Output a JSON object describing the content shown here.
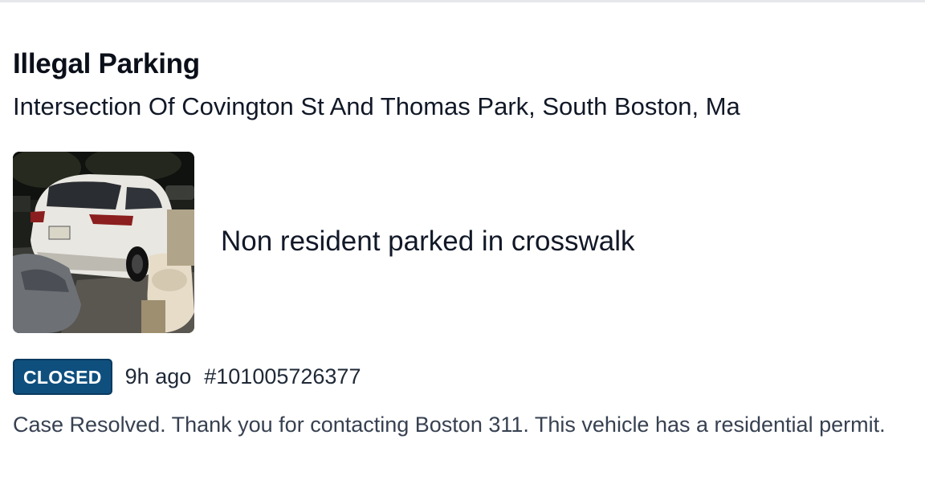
{
  "case": {
    "title": "Illegal Parking",
    "address": "Intersection Of Covington St And Thomas Park, South Boston, Ma",
    "photo_icon": "car-photo",
    "description": "Non resident parked in crosswalk",
    "status": "CLOSED",
    "time_ago": "9h ago",
    "case_number": "#101005726377",
    "resolution_text": "Case Resolved. Thank you for contacting Boston 311. This vehicle has a residential permit."
  },
  "colors": {
    "status_badge_bg": "#0f4f7e",
    "status_badge_text": "#ffffff",
    "title_text": "#0b0f19",
    "body_text": "#374151"
  }
}
